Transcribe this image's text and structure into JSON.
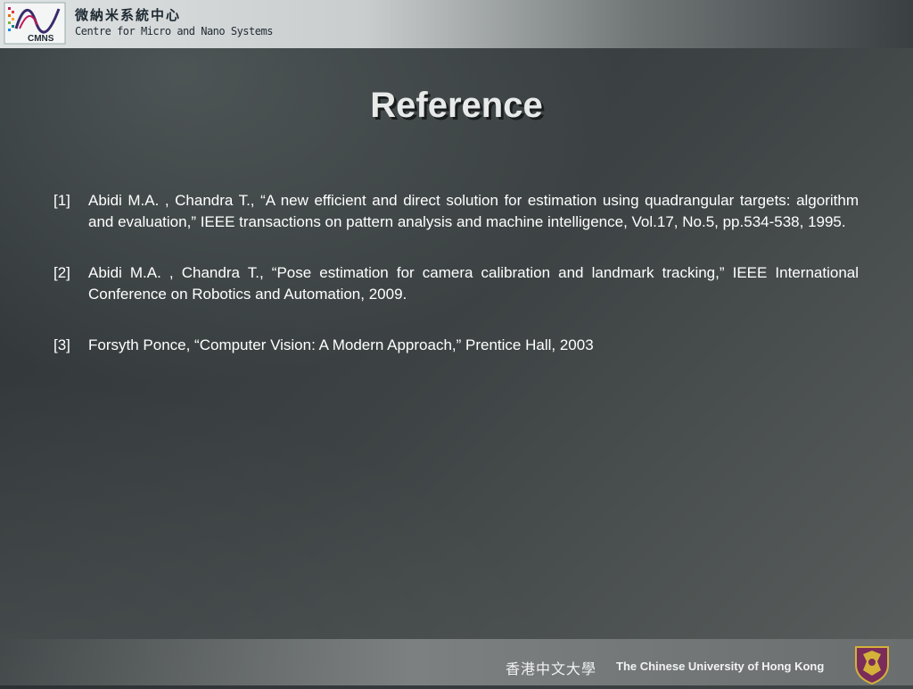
{
  "header": {
    "org_name_cn": "微納米系統中心",
    "org_name_en": "Centre for Micro and Nano Systems",
    "logo_text": "CMNS"
  },
  "slide": {
    "title": "Reference",
    "references": [
      {
        "num": "[1]",
        "text": "Abidi  M.A. , Chandra T., “A new efficient and direct solution for estimation using quadrangular targets: algorithm and evaluation,” IEEE transactions on pattern analysis and machine intelligence, Vol.17, No.5, pp.534-538, 1995."
      },
      {
        "num": "[2]",
        "text": "Abidi  M.A. , Chandra T., “Pose estimation for camera calibration and landmark tracking,” IEEE International Conference on Robotics and Automation, 2009."
      },
      {
        "num": "[3]",
        "text": "Forsyth Ponce, “Computer Vision: A Modern Approach,” Prentice Hall, 2003"
      }
    ]
  },
  "footer": {
    "university_cn": "香港中文大學",
    "university_en": "The Chinese University of Hong Kong"
  }
}
